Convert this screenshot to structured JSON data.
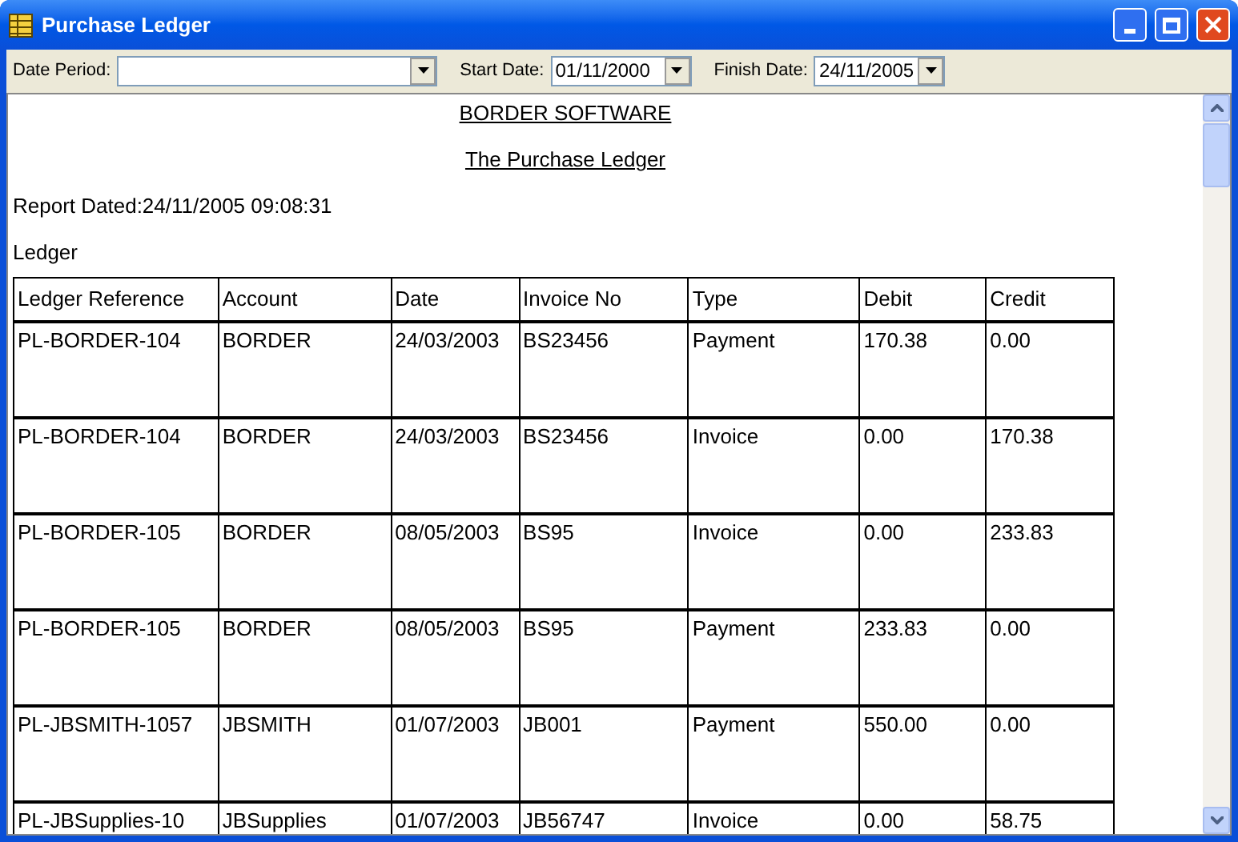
{
  "window": {
    "title": "Purchase Ledger"
  },
  "toolbar": {
    "date_period": {
      "label": "Date Period:"
    },
    "start_date": {
      "label": "Start Date:",
      "value": "01/11/2000"
    },
    "finish_date": {
      "label": "Finish Date:",
      "value": "24/11/2005"
    }
  },
  "report": {
    "company": "BORDER SOFTWARE",
    "title": "The Purchase Ledger",
    "dated": "Report Dated:24/11/2005 09:08:31",
    "section": "Ledger",
    "table": {
      "columns": [
        "Ledger Reference",
        "Account",
        "Date",
        "Invoice No",
        "Type",
        "Debit",
        "Credit"
      ],
      "rows": [
        [
          "PL-BORDER-104",
          "BORDER",
          "24/03/2003",
          "BS23456",
          "Payment",
          "170.38",
          "0.00"
        ],
        [
          "PL-BORDER-104",
          "BORDER",
          "24/03/2003",
          "BS23456",
          "Invoice",
          "0.00",
          "170.38"
        ],
        [
          "PL-BORDER-105",
          "BORDER",
          "08/05/2003",
          "BS95",
          "Invoice",
          "0.00",
          "233.83"
        ],
        [
          "PL-BORDER-105",
          "BORDER",
          "08/05/2003",
          "BS95",
          "Payment",
          "233.83",
          "0.00"
        ],
        [
          "PL-JBSMITH-1057",
          "JBSMITH",
          "01/07/2003",
          "JB001",
          "Payment",
          "550.00",
          "0.00"
        ],
        [
          "PL-JBSupplies-10",
          "JBSupplies",
          "01/07/2003",
          "JB56747",
          "Invoice",
          "0.00",
          "58.75"
        ]
      ]
    }
  }
}
